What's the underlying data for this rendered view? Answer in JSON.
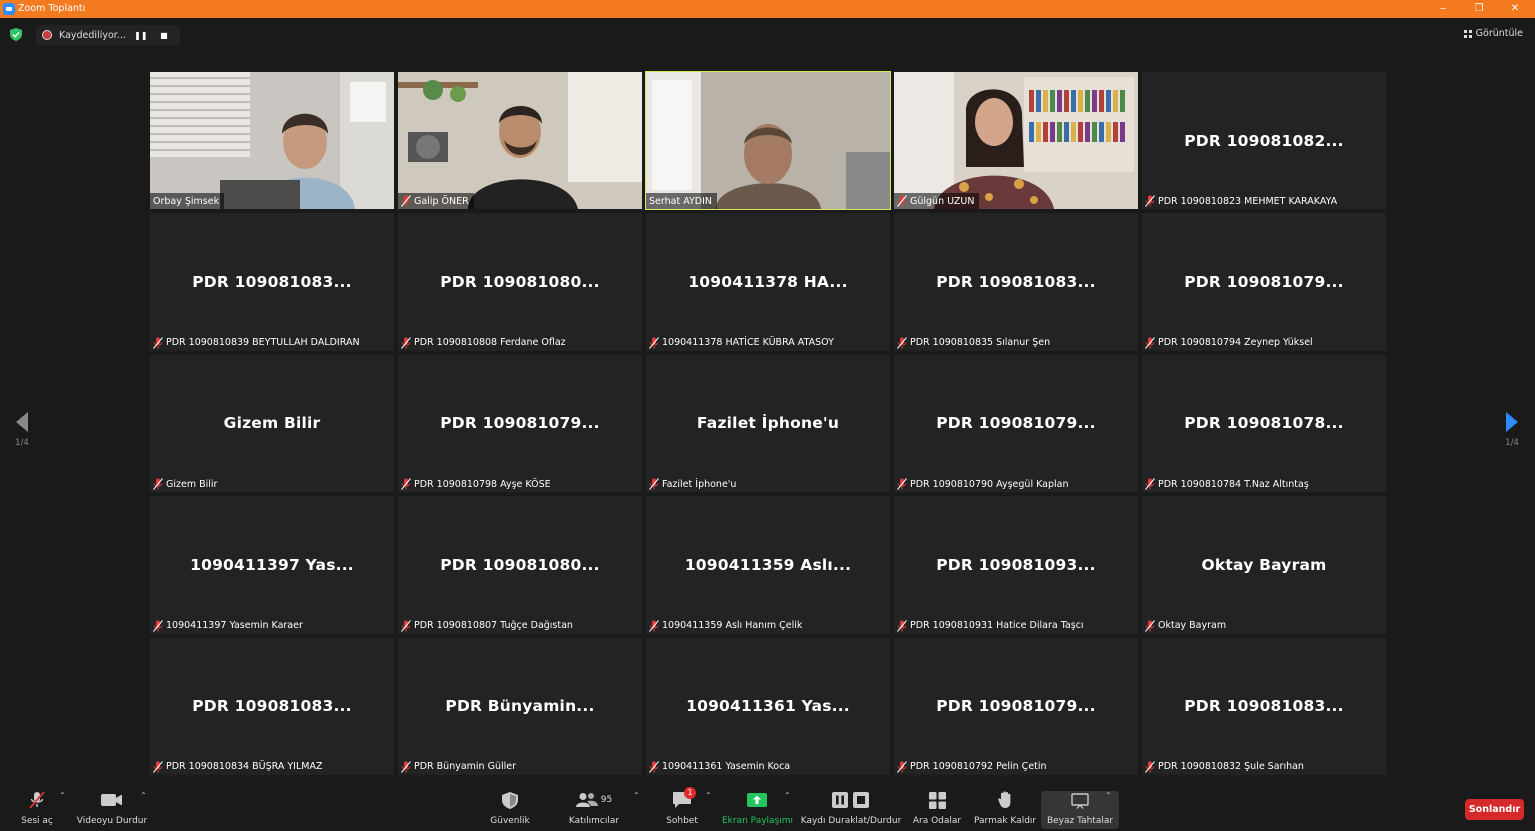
{
  "window": {
    "title": "Zoom Toplantı"
  },
  "topbar": {
    "recording_label": "Kaydediliyor...",
    "view_label": "Görüntüle"
  },
  "pager": {
    "left": "1/4",
    "right": "1/4"
  },
  "participants": [
    {
      "big": "",
      "label": "Orbay Şimsek",
      "video": "v1",
      "muted": false
    },
    {
      "big": "",
      "label": "Galip ÖNER",
      "video": "v2",
      "muted": true
    },
    {
      "big": "",
      "label": "Serhat AYDIN",
      "video": "v3",
      "muted": false,
      "speaking": true
    },
    {
      "big": "",
      "label": "Gülgün UZUN",
      "video": "v4",
      "muted": true
    },
    {
      "big": "PDR 109081082...",
      "label": "PDR 1090810823 MEHMET KARAKAYA",
      "muted": true
    },
    {
      "big": "PDR 109081083...",
      "label": "PDR 1090810839 BEYTULLAH DALDIRAN",
      "muted": true
    },
    {
      "big": "PDR 109081080...",
      "label": "PDR 1090810808 Ferdane Oflaz",
      "muted": true
    },
    {
      "big": "1090411378 HA...",
      "label": "1090411378 HATİCE KÜBRA ATASOY",
      "muted": true
    },
    {
      "big": "PDR 109081083...",
      "label": "PDR 1090810835 Sılanur Şen",
      "muted": true
    },
    {
      "big": "PDR 109081079...",
      "label": "PDR 1090810794 Zeynep Yüksel",
      "muted": true
    },
    {
      "big": "Gizem Bilir",
      "label": "Gizem Bilir",
      "muted": true
    },
    {
      "big": "PDR 109081079...",
      "label": "PDR 1090810798 Ayşe KÖSE",
      "muted": true
    },
    {
      "big": "Fazilet İphone'u",
      "label": "Fazilet İphone'u",
      "muted": true
    },
    {
      "big": "PDR 109081079...",
      "label": "PDR 1090810790 Ayşegül Kaplan",
      "muted": true
    },
    {
      "big": "PDR 109081078...",
      "label": "PDR 1090810784 T.Naz Altıntaş",
      "muted": true
    },
    {
      "big": "1090411397 Yas...",
      "label": "1090411397 Yasemin Karaer",
      "muted": true
    },
    {
      "big": "PDR 109081080...",
      "label": "PDR 1090810807 Tuğçe Dağıstan",
      "muted": true
    },
    {
      "big": "1090411359 Aslı...",
      "label": "1090411359 Aslı Hanım Çelik",
      "muted": true
    },
    {
      "big": "PDR 109081093...",
      "label": "PDR 1090810931 Hatice Dilara Taşcı",
      "muted": true
    },
    {
      "big": "Oktay Bayram",
      "label": "Oktay Bayram",
      "muted": true
    },
    {
      "big": "PDR 109081083...",
      "label": "PDR 1090810834 BÜŞRA YILMAZ",
      "muted": true
    },
    {
      "big": "PDR  Bünyamin...",
      "label": "PDR Bünyamin Güller",
      "muted": true
    },
    {
      "big": "1090411361 Yas...",
      "label": "1090411361 Yasemin Koca",
      "muted": true
    },
    {
      "big": "PDR 109081079...",
      "label": "PDR 1090810792 Pelin Çetin",
      "muted": true
    },
    {
      "big": "PDR 109081083...",
      "label": "PDR 1090810832 Şule Sarıhan",
      "muted": true
    }
  ],
  "toolbar": {
    "audio": "Sesi aç",
    "video": "Videoyu Durdur",
    "security": "Güvenlik",
    "participants": "Katılımcılar",
    "participant_count": "95",
    "chat": "Sohbet",
    "chat_badge": "1",
    "share": "Ekran Paylaşımı",
    "record": "Kaydı Duraklat/Durdur",
    "breakout": "Ara Odalar",
    "reactions": "Parmak Kaldır",
    "whiteboard": "Beyaz Tahtalar",
    "end": "Sonlandır"
  },
  "colors": {
    "titlebar": "#f47a20",
    "share_green": "#22c55e",
    "end_red": "#d42a2a",
    "speaker_highlight": "#d8e65a",
    "nav_arrow_active": "#2d8cff"
  }
}
